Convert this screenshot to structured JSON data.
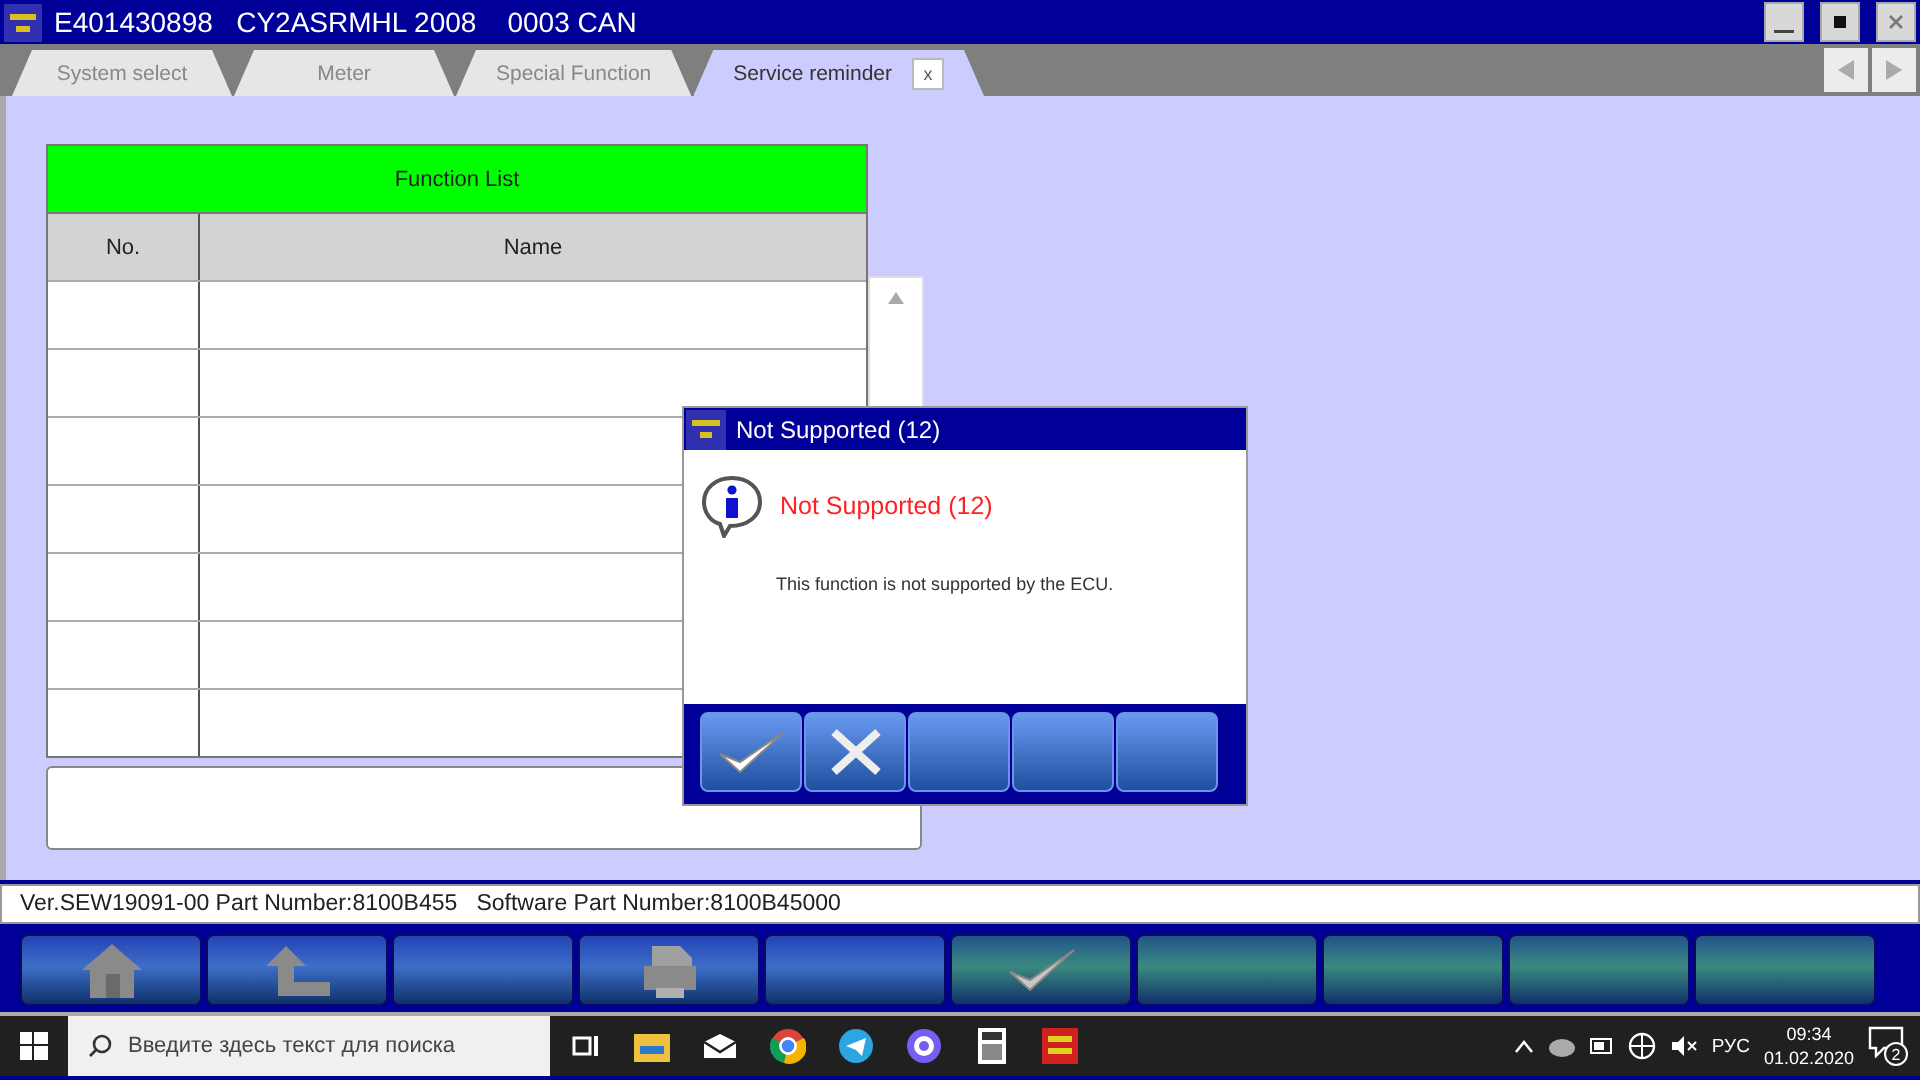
{
  "window": {
    "title": "E401430898   CY2ASRMHL 2008    0003 CAN"
  },
  "tabs": [
    {
      "label": "System select",
      "selected": false
    },
    {
      "label": "Meter",
      "selected": false
    },
    {
      "label": "Special Function",
      "selected": false
    },
    {
      "label": "Service reminder",
      "selected": true,
      "close_label": "x"
    }
  ],
  "function_list": {
    "title": "Function List",
    "columns": [
      "No.",
      "Name"
    ]
  },
  "dialog": {
    "title": "Not Supported (12)",
    "heading": "Not Supported (12)",
    "message": "This function is not supported by the ECU.",
    "buttons": [
      {
        "kind": "ok"
      },
      {
        "kind": "cancel"
      },
      {
        "kind": "blank"
      },
      {
        "kind": "blank"
      },
      {
        "kind": "blank"
      }
    ]
  },
  "status_bar": "Ver.SEW19091-00 Part Number:8100B455   Software Part Number:8100B45000",
  "toolbar": [
    {
      "kind": "home",
      "color": "#3d6fc8"
    },
    {
      "kind": "back",
      "color": "#3d6fc8"
    },
    {
      "kind": "blank",
      "color": "#3d6fc8"
    },
    {
      "kind": "print",
      "color": "#3d6fc8"
    },
    {
      "kind": "blank",
      "color": "#3d6fc8"
    },
    {
      "kind": "ok",
      "color": "#3a8a80"
    },
    {
      "kind": "blank",
      "color": "#3a8a80"
    },
    {
      "kind": "blank",
      "color": "#3a8a80"
    },
    {
      "kind": "blank",
      "color": "#3a8a80"
    },
    {
      "kind": "blank",
      "color": "#3a8a80"
    }
  ],
  "taskbar": {
    "search_placeholder": "Введите здесь текст для поиска",
    "language": "РУС",
    "time": "09:34",
    "date": "01.02.2020",
    "notifications": "2"
  }
}
